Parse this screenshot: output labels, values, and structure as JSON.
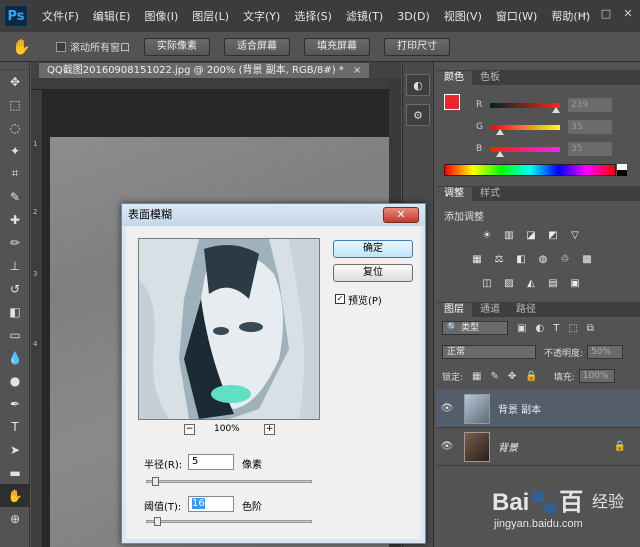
{
  "app": {
    "logo": "Ps"
  },
  "menu": [
    "文件(F)",
    "编辑(E)",
    "图像(I)",
    "图层(L)",
    "文字(Y)",
    "选择(S)",
    "滤镜(T)",
    "3D(D)",
    "视图(V)",
    "窗口(W)",
    "帮助(H)"
  ],
  "window_controls": {
    "minimize": "—",
    "maximize": "□",
    "close": "✕"
  },
  "options_bar": {
    "scroll_all_label": "滚动所有窗口",
    "buttons": [
      "实际像素",
      "适合屏幕",
      "填充屏幕",
      "打印尺寸"
    ]
  },
  "document": {
    "tab_title": "QQ截图20160908151022.jpg @ 200% (背景 副本, RGB/8#) *",
    "close": "×"
  },
  "rulers": {
    "left": [
      "1",
      "2",
      "3",
      "4"
    ]
  },
  "panels": {
    "color": {
      "tabs": [
        "颜色",
        "色板"
      ],
      "sliders": [
        {
          "letter": "R",
          "value": "239",
          "fraction": 0.94
        },
        {
          "letter": "G",
          "value": "35",
          "fraction": 0.14
        },
        {
          "letter": "B",
          "value": "35",
          "fraction": 0.14
        }
      ],
      "fg_color": "#e8262b",
      "bg_color": "#ffffff"
    },
    "adjustments": {
      "tabs": [
        "调整",
        "样式"
      ],
      "label": "添加调整"
    },
    "layers": {
      "tabs": [
        "图层",
        "通道",
        "路径"
      ],
      "filter_label": "类型",
      "blend_mode": "正常",
      "opacity_label": "不透明度:",
      "opacity_value": "50%",
      "lock_label": "锁定:",
      "fill_label": "填充:",
      "fill_value": "100%",
      "items": [
        {
          "name": "背景 副本",
          "selected": true
        },
        {
          "name": "背景",
          "selected": false
        }
      ]
    }
  },
  "dialog": {
    "title": "表面模糊",
    "close": "✕",
    "ok": "确定",
    "reset": "复位",
    "preview_label": "预览(P)",
    "preview_checked": "✓",
    "zoom_out": "−",
    "zoom_in": "+",
    "zoom": "100%",
    "radius": {
      "label": "半径(R):",
      "value": "5",
      "unit": "像素",
      "fraction": 0.03
    },
    "threshold": {
      "label": "阈值(T):",
      "value": "16",
      "unit": "色阶",
      "fraction": 0.04
    }
  },
  "watermark": {
    "brand": "Bai🐾百",
    "brand_tail": "经验",
    "url": "jingyan.baidu.com"
  }
}
